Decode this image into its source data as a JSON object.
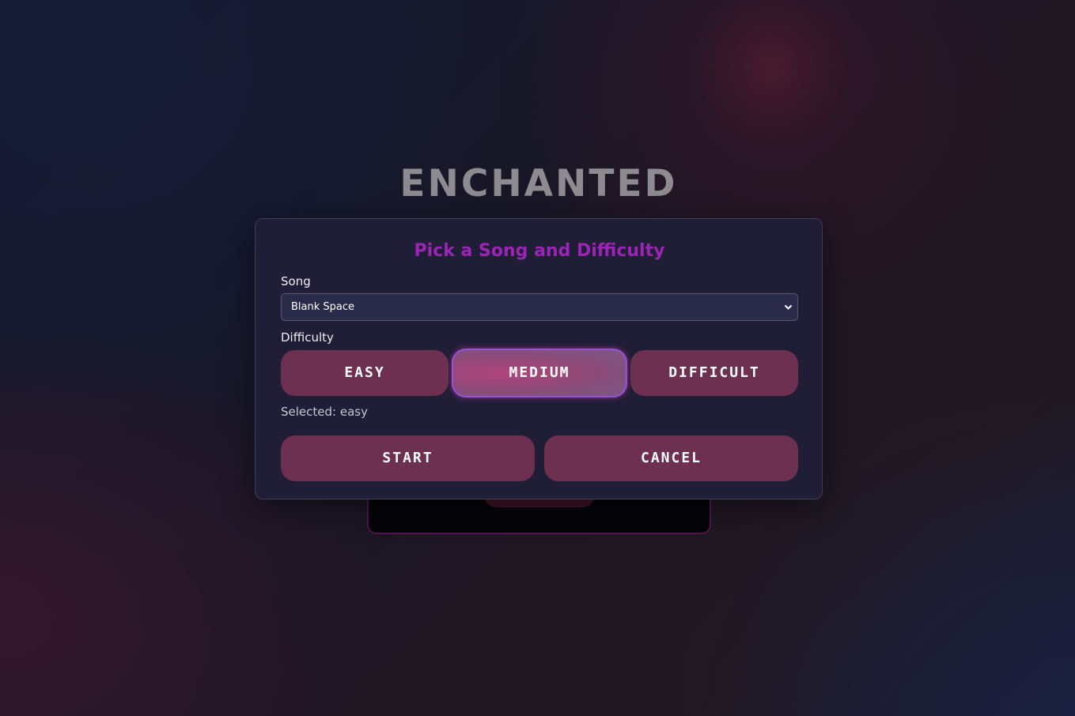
{
  "logo": {
    "text": "ENCHANTED"
  },
  "dialog": {
    "title": "Pick a Song and Difficulty",
    "song_label": "Song",
    "song_selected": "Blank Space",
    "difficulty_label": "Difficulty",
    "difficulty_options": [
      "easy",
      "medium",
      "difficult"
    ],
    "highlighted_option": "medium",
    "selected_text": "Selected: easy",
    "start_label": "start",
    "cancel_label": "cancel"
  },
  "icons": {
    "select_chevron": "chevron-down-icon"
  },
  "colors": {
    "title": "#9b25b4",
    "button": "#6e3050",
    "modal_bg": "#1f1e36",
    "logo": "#8d8b90"
  }
}
